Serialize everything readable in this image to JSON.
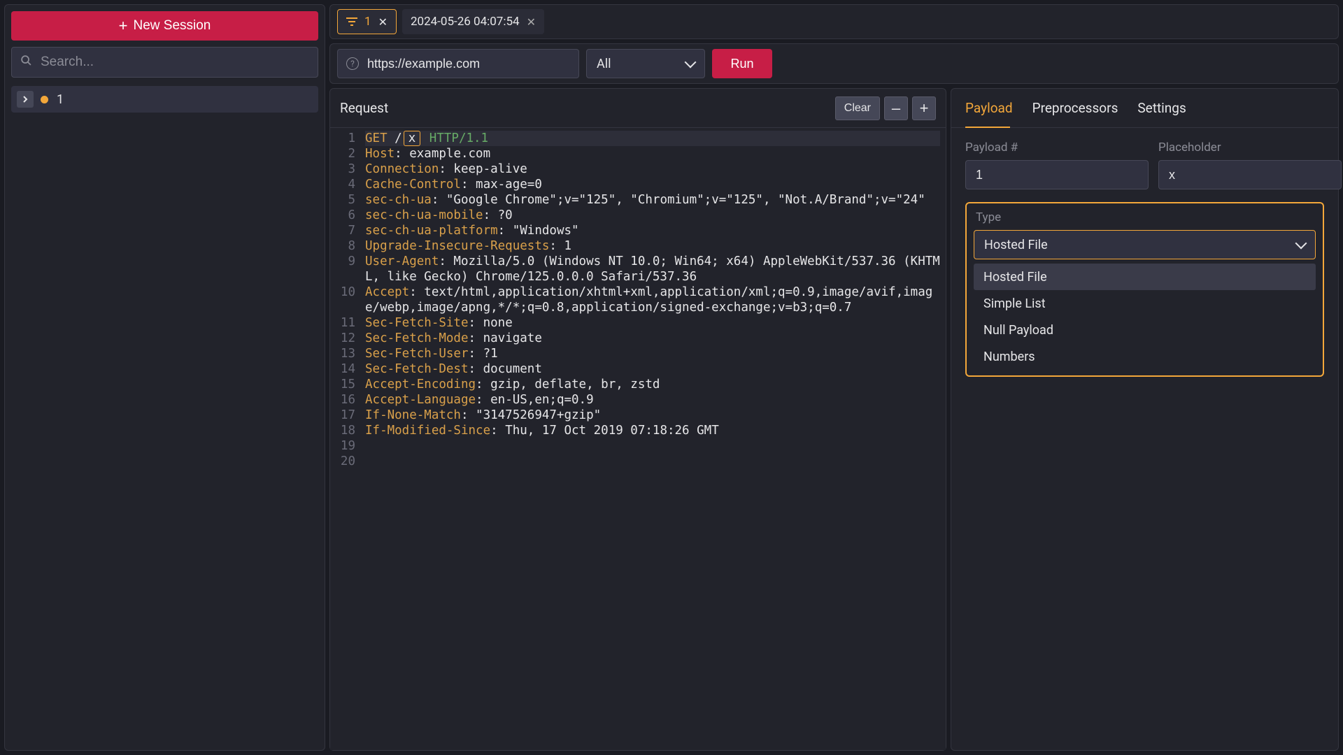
{
  "sidebar": {
    "new_session_label": "New Session",
    "search_placeholder": "Search...",
    "sessions": [
      {
        "label": "1"
      }
    ]
  },
  "tabs": [
    {
      "label": "1",
      "active": true,
      "icon": "filter"
    },
    {
      "label": "2024-05-26 04:07:54",
      "active": false
    }
  ],
  "urlbar": {
    "value": "https://example.com",
    "scope_label": "All",
    "run_label": "Run"
  },
  "request": {
    "title": "Request",
    "clear_label": "Clear",
    "minus_label": "–",
    "plus_label": "+",
    "lines": [
      {
        "n": 1,
        "segments": [
          {
            "t": "GET ",
            "c": "k"
          },
          {
            "t": "/",
            "c": ""
          },
          {
            "t": "x",
            "c": "mark"
          },
          {
            "t": " ",
            "c": ""
          },
          {
            "t": "HTTP/1.1",
            "c": "p"
          }
        ],
        "bg": true
      },
      {
        "n": 2,
        "segments": [
          {
            "t": "Host",
            "c": "k"
          },
          {
            "t": ": example.com",
            "c": ""
          }
        ]
      },
      {
        "n": 3,
        "segments": [
          {
            "t": "Connection",
            "c": "k"
          },
          {
            "t": ": keep-alive",
            "c": ""
          }
        ]
      },
      {
        "n": 4,
        "segments": [
          {
            "t": "Cache-Control",
            "c": "k"
          },
          {
            "t": ": max-age=0",
            "c": ""
          }
        ]
      },
      {
        "n": 5,
        "segments": [
          {
            "t": "sec-ch-ua",
            "c": "k"
          },
          {
            "t": ": \"Google Chrome\";v=\"125\", \"Chromium\";v=\"125\", \"Not.A/Brand\";v=\"24\"",
            "c": ""
          }
        ]
      },
      {
        "n": 6,
        "segments": [
          {
            "t": "sec-ch-ua-mobile",
            "c": "k"
          },
          {
            "t": ": ?0",
            "c": ""
          }
        ]
      },
      {
        "n": 7,
        "segments": [
          {
            "t": "sec-ch-ua-platform",
            "c": "k"
          },
          {
            "t": ": \"Windows\"",
            "c": ""
          }
        ]
      },
      {
        "n": 8,
        "segments": [
          {
            "t": "Upgrade-Insecure-Requests",
            "c": "k"
          },
          {
            "t": ": 1",
            "c": ""
          }
        ]
      },
      {
        "n": 9,
        "segments": [
          {
            "t": "User-Agent",
            "c": "k"
          },
          {
            "t": ": Mozilla/5.0 (Windows NT 10.0; Win64; x64) AppleWebKit/537.36 (KHTML, like Gecko) Chrome/125.0.0.0 Safari/537.36",
            "c": ""
          }
        ]
      },
      {
        "n": 10,
        "segments": [
          {
            "t": "Accept",
            "c": "k"
          },
          {
            "t": ": text/html,application/xhtml+xml,application/xml;q=0.9,image/avif,image/webp,image/apng,*/*;q=0.8,application/signed-exchange;v=b3;q=0.7",
            "c": ""
          }
        ]
      },
      {
        "n": 11,
        "segments": [
          {
            "t": "Sec-Fetch-Site",
            "c": "k"
          },
          {
            "t": ": none",
            "c": ""
          }
        ]
      },
      {
        "n": 12,
        "segments": [
          {
            "t": "Sec-Fetch-Mode",
            "c": "k"
          },
          {
            "t": ": navigate",
            "c": ""
          }
        ]
      },
      {
        "n": 13,
        "segments": [
          {
            "t": "Sec-Fetch-User",
            "c": "k"
          },
          {
            "t": ": ?1",
            "c": ""
          }
        ]
      },
      {
        "n": 14,
        "segments": [
          {
            "t": "Sec-Fetch-Dest",
            "c": "k"
          },
          {
            "t": ": document",
            "c": ""
          }
        ]
      },
      {
        "n": 15,
        "segments": [
          {
            "t": "Accept-Encoding",
            "c": "k"
          },
          {
            "t": ": gzip, deflate, br, zstd",
            "c": ""
          }
        ]
      },
      {
        "n": 16,
        "segments": [
          {
            "t": "Accept-Language",
            "c": "k"
          },
          {
            "t": ": en-US,en;q=0.9",
            "c": ""
          }
        ]
      },
      {
        "n": 17,
        "segments": [
          {
            "t": "If-None-Match",
            "c": "k"
          },
          {
            "t": ": \"3147526947+gzip\"",
            "c": ""
          }
        ]
      },
      {
        "n": 18,
        "segments": [
          {
            "t": "If-Modified-Since",
            "c": "k"
          },
          {
            "t": ": Thu, 17 Oct 2019 07:18:26 GMT",
            "c": ""
          }
        ]
      },
      {
        "n": 19,
        "segments": []
      },
      {
        "n": 20,
        "segments": []
      }
    ]
  },
  "right": {
    "tabs": [
      "Payload",
      "Preprocessors",
      "Settings"
    ],
    "active_tab": "Payload",
    "payload_num_label": "Payload #",
    "payload_num_value": "1",
    "placeholder_label": "Placeholder",
    "placeholder_value": "x",
    "type_label": "Type",
    "type_selected": "Hosted File",
    "type_options": [
      "Hosted File",
      "Simple List",
      "Null Payload",
      "Numbers"
    ]
  }
}
